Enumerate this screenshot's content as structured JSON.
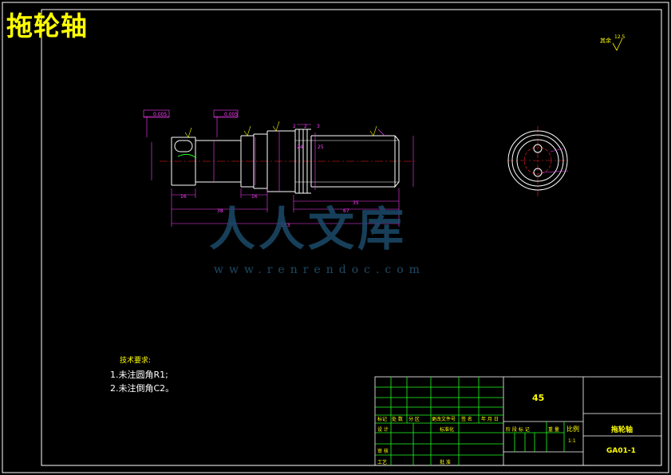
{
  "title": "拖轮轴",
  "watermark": {
    "logo": "人人文库",
    "url": "www.renrendoc.com"
  },
  "roughness": {
    "label": "其余",
    "value": "12.5"
  },
  "dimensions": {
    "tol_left": "0.005",
    "tol_mid": "0.005",
    "d_16a": "16",
    "d_16b": "16",
    "d_38": "38",
    "d_35": "35",
    "d_67": "67",
    "d_143": "143",
    "d_2a": "2",
    "d_2b": "2",
    "d_3": "3",
    "d_25": "25",
    "d_24": "24"
  },
  "notes": {
    "heading": "技术要求:",
    "line1": "1.未注圆角R1;",
    "line2": "2.未注倒角C2。"
  },
  "titleblock": {
    "material": "45",
    "part_name": "拖轮轴",
    "drawing_no": "GA01-1",
    "scale_label": "比例",
    "scale_value": "1:1",
    "mark": "标记",
    "count": "处 数",
    "zone": "分 区",
    "change_doc": "更改文件号",
    "signature": "签 名",
    "date": "年 月 日",
    "design": "设 计",
    "standardize": "标准化",
    "review": "审 核",
    "process": "工艺",
    "approve": "批 准",
    "stage_mark": "阶 段 标 记",
    "weight": "重 量"
  }
}
